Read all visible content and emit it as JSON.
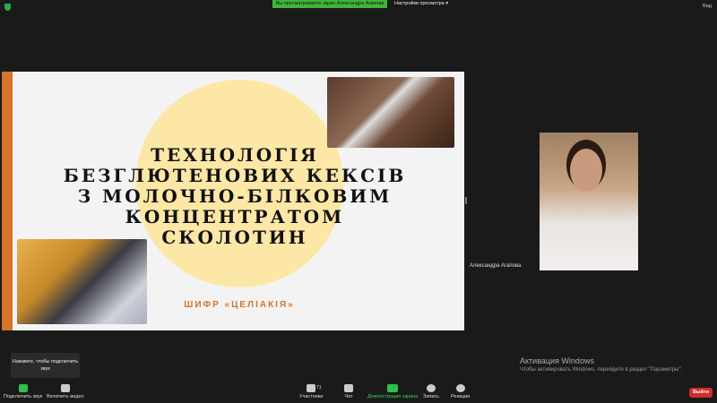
{
  "top": {
    "banner": "Вы просматриваете экран Александра Агапова",
    "view_options": "Настройки просмотра ▾",
    "view_button": "Вид"
  },
  "slide": {
    "title_lines": [
      "ТЕХНОЛОГІЯ",
      "БЕЗГЛЮТЕНОВИХ КЕКСІВ",
      "З МОЛОЧНО-БІЛКОВИМ",
      "КОНЦЕНТРАТОМ",
      "СКОЛОТИН"
    ],
    "subtitle": "ШИФР «ЦЕЛІАКІЯ»"
  },
  "participant": {
    "name": "Александра Агапова"
  },
  "tooltip": "Нажмите, чтобы подключить звук",
  "toolbar": {
    "audio": "Подключить звук",
    "video": "Включить видео",
    "participants": "Участники",
    "participants_count": "71",
    "chat": "Чат",
    "share": "Демонстрация экрана",
    "record": "Запись",
    "reactions": "Реакции",
    "leave": "Выйти"
  },
  "watermark": {
    "title": "Активация Windows",
    "text": "Чтобы активировать Windows, перейдите в раздел \"Параметры\"."
  }
}
